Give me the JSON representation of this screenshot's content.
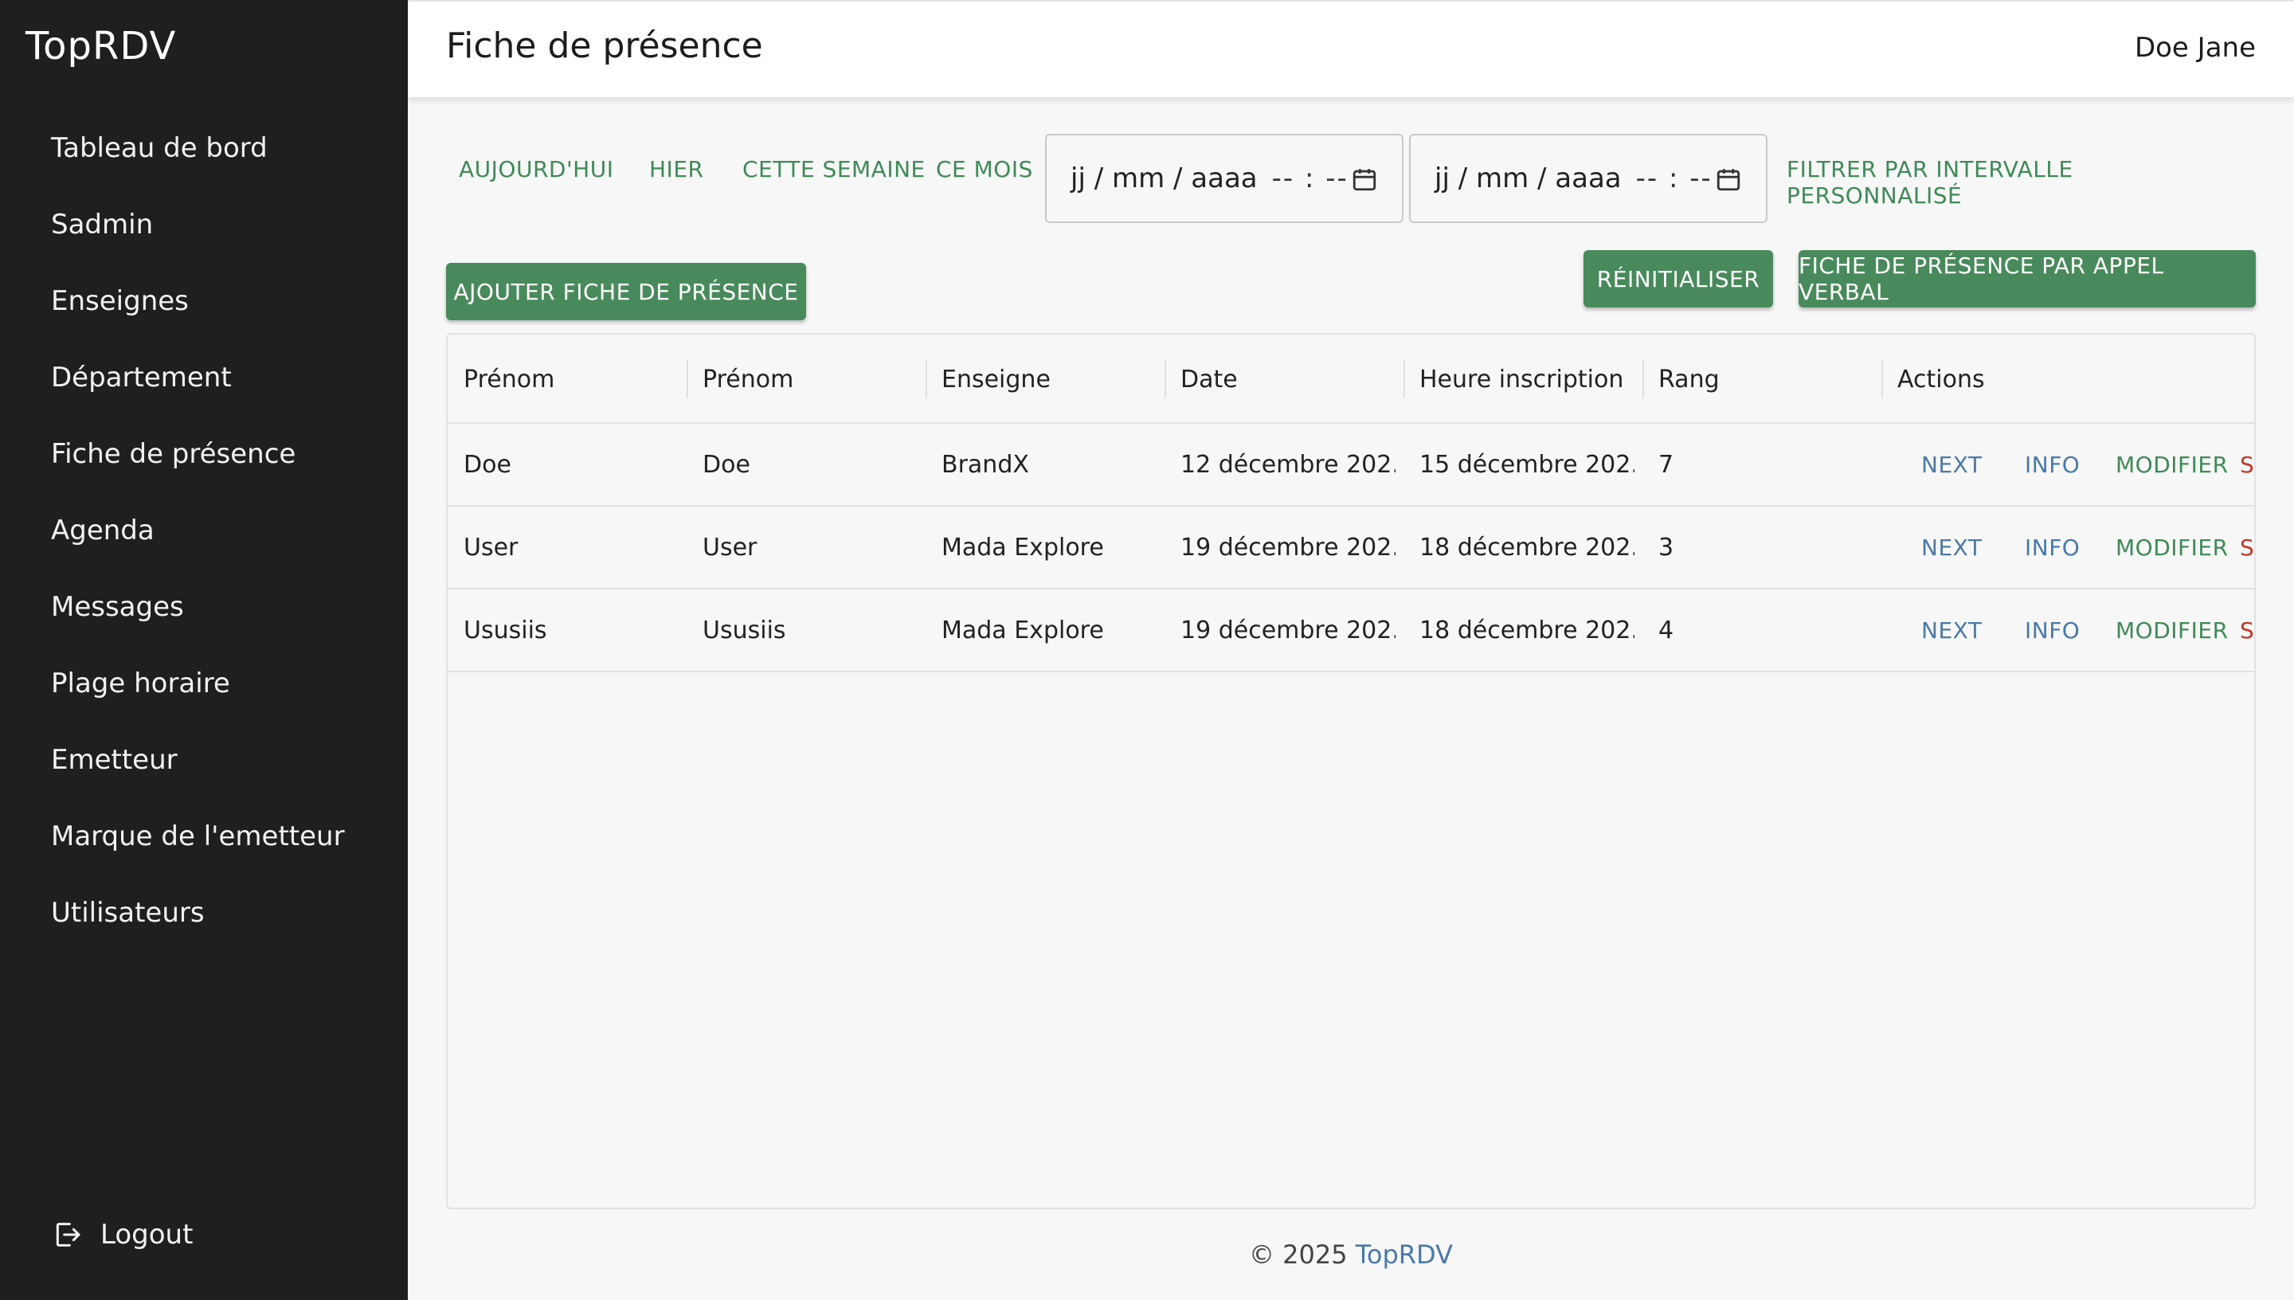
{
  "sidebar": {
    "brand": "TopRDV",
    "items": [
      {
        "label": "Tableau de bord"
      },
      {
        "label": "Sadmin"
      },
      {
        "label": "Enseignes"
      },
      {
        "label": "Département"
      },
      {
        "label": "Fiche de présence"
      },
      {
        "label": "Agenda"
      },
      {
        "label": "Messages"
      },
      {
        "label": "Plage horaire"
      },
      {
        "label": "Emetteur"
      },
      {
        "label": "Marque de l'emetteur"
      },
      {
        "label": "Utilisateurs"
      }
    ],
    "logout_label": "Logout"
  },
  "header": {
    "title": "Fiche de présence",
    "user": "Doe Jane"
  },
  "filters": {
    "today": "AUJOURD'HUI",
    "yesterday": "HIER",
    "this_week": "CETTE SEMAINE",
    "this_month": "CE MOIS",
    "start_date_placeholder": "jj / mm / aaaa",
    "start_time_placeholder": "-- : --",
    "end_date_placeholder": "jj / mm / aaaa",
    "end_time_placeholder": "-- : --",
    "custom_range": "FILTRER PAR INTERVALLE PERSONNALISÉ"
  },
  "actions": {
    "add": "AJOUTER FICHE DE PRÉSENCE",
    "reset": "RÉINITIALISER",
    "verbal": "FICHE DE PRÉSENCE PAR APPEL VERBAL"
  },
  "table": {
    "columns": [
      "Prénom",
      "Prénom",
      "Enseigne",
      "Date",
      "Heure inscription",
      "Rang",
      "Actions"
    ],
    "rows": [
      {
        "first": "Doe",
        "last": "Doe",
        "brand": "BrandX",
        "date": "12 décembre 202...",
        "time": "15 décembre 202...",
        "rank": "7"
      },
      {
        "first": "User",
        "last": "User",
        "brand": "Mada Explore",
        "date": "19 décembre 202...",
        "time": "18 décembre 202...",
        "rank": "3"
      },
      {
        "first": "Ususiis",
        "last": "Ususiis",
        "brand": "Mada Explore",
        "date": "19 décembre 202...",
        "time": "18 décembre 202...",
        "rank": "4"
      }
    ],
    "row_actions": {
      "next": "NEXT",
      "info": "INFO",
      "edit": "MODIFIER",
      "delete": "S"
    }
  },
  "footer": {
    "copyright": "© 2025",
    "link": "TopRDV"
  },
  "colors": {
    "sidebar_bg": "#1f1f1f",
    "primary_green": "#498a5c",
    "link_blue": "#4a79a8",
    "danger_red": "#c0392b"
  }
}
